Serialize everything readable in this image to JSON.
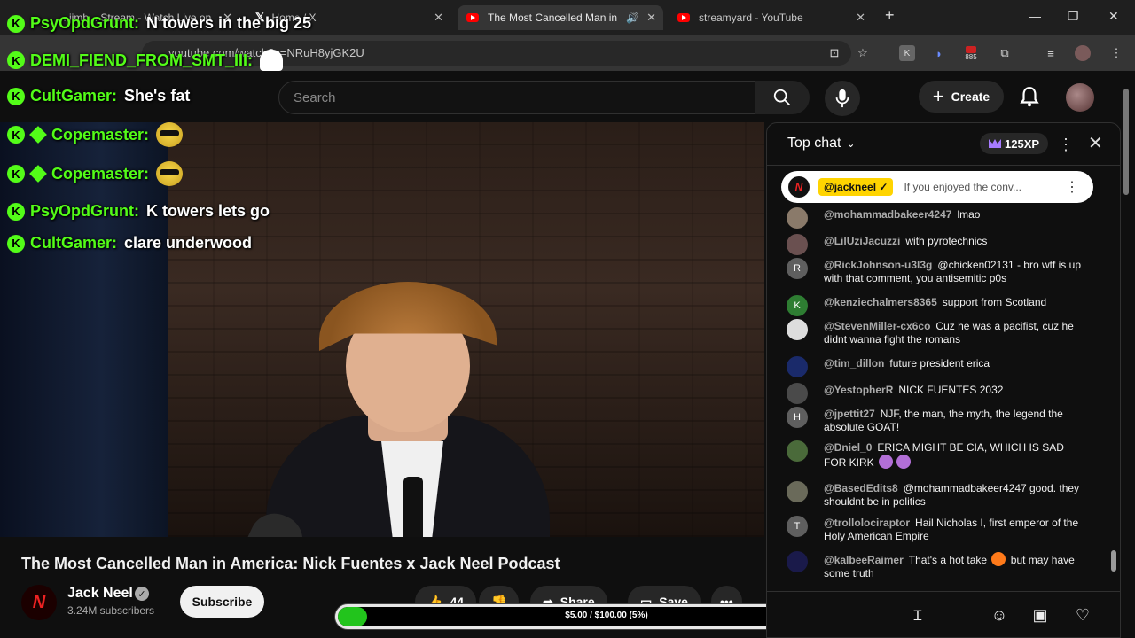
{
  "browser": {
    "tabs": [
      {
        "title": "...jimb... Stream - Watch Live on",
        "icon": "kick-icon"
      },
      {
        "title": "Home / X",
        "icon": "x-logo-icon"
      },
      {
        "title": "The Most Cancelled Man in",
        "icon": "youtube-icon",
        "active": true
      },
      {
        "title": "streamyard - YouTube",
        "icon": "youtube-icon"
      }
    ],
    "url": "youtube.com/watch?v=NRuH8yjGK2U",
    "extension_badge": "885"
  },
  "youtube": {
    "search_placeholder": "Search",
    "create_label": "Create",
    "country": "GB"
  },
  "overlay_chat": [
    {
      "user": "PsyOpdGrunt:",
      "message": "N towers in the big 25",
      "badge": "K"
    },
    {
      "user": "DEMI_FIEND_FROM_SMT_III:",
      "message": "",
      "badge": "K",
      "emote": true
    },
    {
      "user": "CultGamer:",
      "message": "She's fat",
      "badge": "K"
    },
    {
      "user": "Copemaster:",
      "message": "",
      "badge": "K",
      "emote": true
    },
    {
      "user": "Copemaster:",
      "message": "",
      "badge": "K",
      "emote": true
    },
    {
      "user": "PsyOpdGrunt:",
      "message": "K towers lets go",
      "badge": "K"
    },
    {
      "user": "CultGamer:",
      "message": "clare underwood",
      "badge": "K"
    }
  ],
  "video": {
    "title": "The Most Cancelled Man in America: Nick Fuentes x Jack Neel Podcast",
    "channel": "Jack Neel",
    "subscribers": "3.24M subscribers",
    "subscribe_label": "Subscribe",
    "likes": "44",
    "share_label": "Share",
    "save_label": "Save"
  },
  "donation_goal": {
    "text": "$5.00 / $100.00 (5%)",
    "progress": 0.05,
    "color": "#22c41c"
  },
  "chat": {
    "header": "Top chat",
    "xp": "125XP",
    "pinned": {
      "user": "@jackneel",
      "text": "If you enjoyed the conv..."
    },
    "messages": [
      {
        "user": "@mohammadbakeer4247",
        "text": "lmao",
        "avatar_letter": "",
        "avatar_color": "#8a7a6a"
      },
      {
        "user": "@LilUziJacuzzi",
        "text": "with pyrotechnics",
        "avatar_letter": "",
        "avatar_color": "#6a5050"
      },
      {
        "user": "@RickJohnson-u3l3g",
        "text": "@chicken02131 - bro wtf is up with that comment, you antisemitic p0s",
        "avatar_letter": "R",
        "avatar_color": "#5f5f5f"
      },
      {
        "user": "@kenziechalmers8365",
        "text": "support from Scotland",
        "avatar_letter": "K",
        "avatar_color": "#2e7d32"
      },
      {
        "user": "@StevenMiller-cx6co",
        "text": "Cuz he was a pacifist, cuz he didnt wanna fight the romans",
        "avatar_letter": "",
        "avatar_color": "#ddd"
      },
      {
        "user": "@tim_dillon",
        "text": "future president erica",
        "avatar_letter": "",
        "avatar_color": "#1a2a6a"
      },
      {
        "user": "@YestopherR",
        "text": "NICK FUENTES 2032",
        "avatar_letter": "",
        "avatar_color": "#4a4a4a"
      },
      {
        "user": "@jpettit27",
        "text": "NJF, the man, the myth, the legend the absolute GOAT!",
        "avatar_letter": "H",
        "avatar_color": "#5f5f5f"
      },
      {
        "user": "@Dniel_0",
        "text": "ERICA MIGHT BE CIA, WHICH IS SAD FOR KIRK",
        "avatar_letter": "",
        "avatar_color": "#4a6a3a"
      },
      {
        "user": "@BasedEdits8",
        "text": "@mohammadbakeer4247 good. they shouldnt be in politics",
        "avatar_letter": "",
        "avatar_color": "#6a6a5a"
      },
      {
        "user": "@trollolociraptor",
        "text": "Hail Nicholas I, first emperor of the Holy American Empire",
        "avatar_letter": "T",
        "avatar_color": "#5f5f5f"
      },
      {
        "user": "@kalbeeRaimer",
        "text": "That's a hot take",
        "text2": "but may have some truth",
        "avatar_letter": "",
        "avatar_color": "#1a1a4a"
      }
    ]
  }
}
